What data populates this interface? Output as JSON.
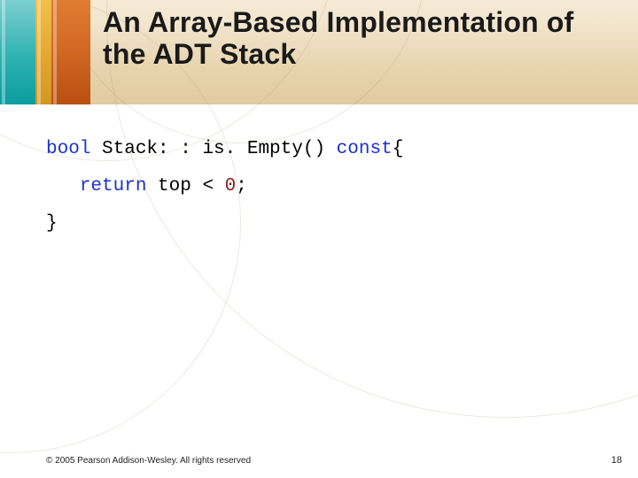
{
  "title": "An Array-Based Implementation of the ADT Stack",
  "code": {
    "line1": {
      "kw_bool": "bool",
      "mid": " Stack: : is. Empty() ",
      "kw_const": "const",
      "tail": "{"
    },
    "line2": {
      "indent": "   ",
      "kw_return": "return",
      "mid": " top < ",
      "num_zero": "0",
      "tail": ";"
    },
    "line3": "}"
  },
  "footer": {
    "copyright": "© 2005 Pearson Addison-Wesley. All rights reserved",
    "page_number": "18"
  }
}
